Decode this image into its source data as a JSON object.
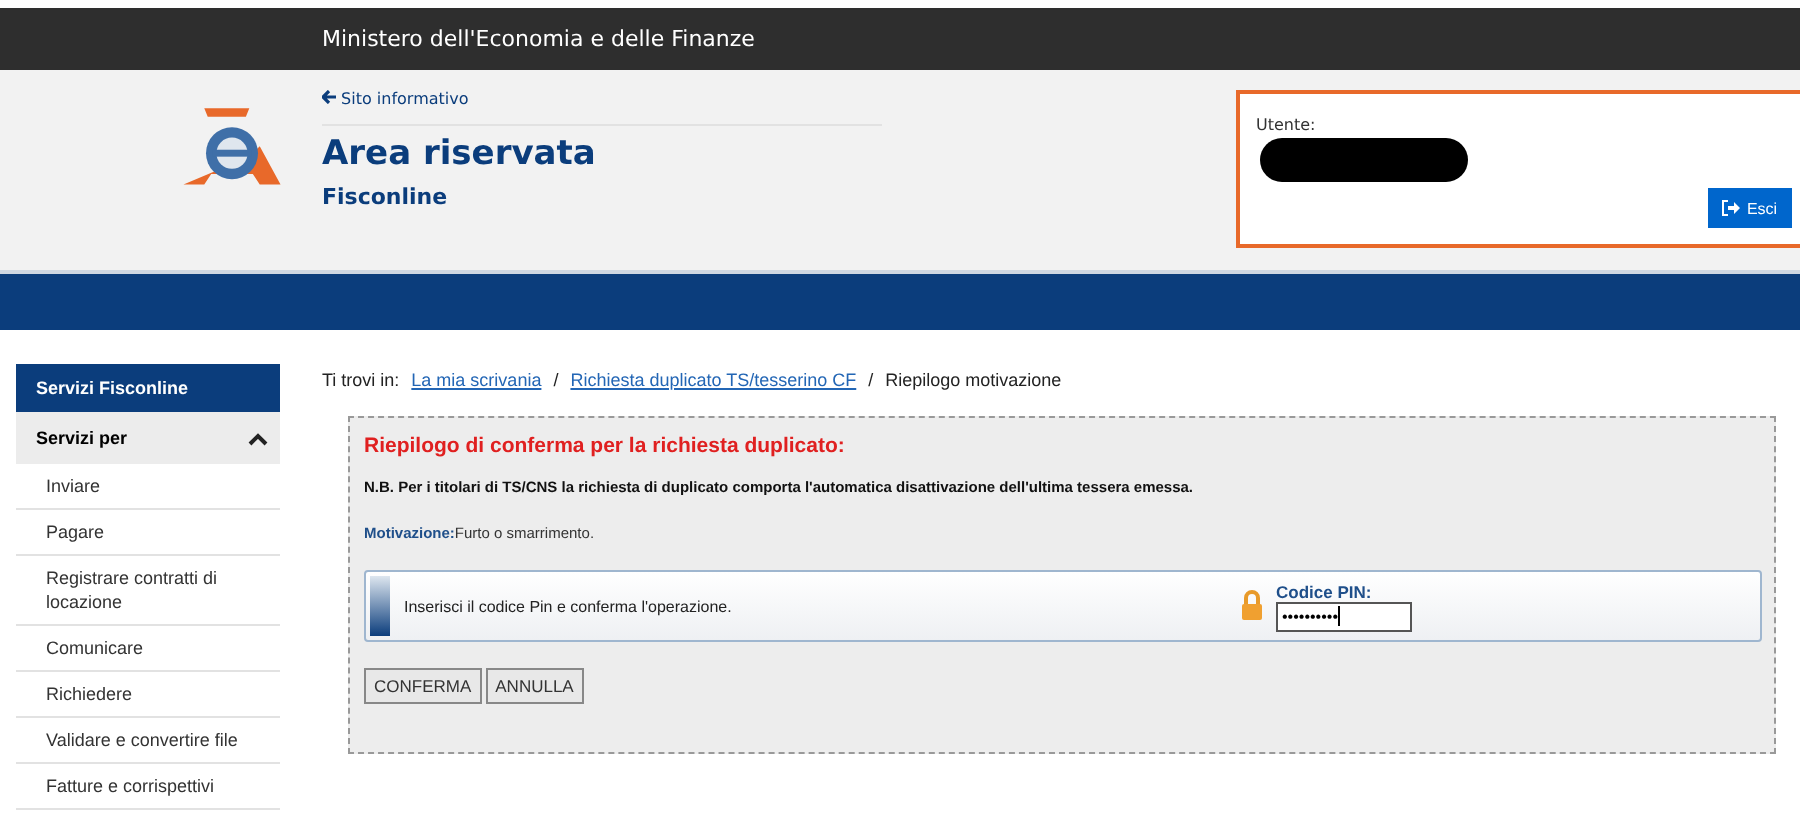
{
  "top_bar": {
    "title": "Ministero dell'Economia e delle Finanze"
  },
  "header": {
    "back_link": "Sito informativo",
    "title": "Area riservata",
    "subtitle": "Fisconline"
  },
  "user_box": {
    "label": "Utente:",
    "logout_button": "Esci"
  },
  "sidebar": {
    "title": "Servizi Fisconline",
    "group": {
      "label": "Servizi per",
      "expanded": true
    },
    "items": [
      {
        "label": "Inviare"
      },
      {
        "label": "Pagare"
      },
      {
        "label": "Registrare contratti di locazione"
      },
      {
        "label": "Comunicare"
      },
      {
        "label": "Richiedere"
      },
      {
        "label": "Validare e convertire file"
      },
      {
        "label": "Fatture e corrispettivi"
      }
    ]
  },
  "breadcrumb": {
    "prefix": "Ti trovi in:",
    "parts": [
      {
        "kind": "link",
        "text": "La mia scrivania"
      },
      {
        "kind": "separator",
        "text": "/"
      },
      {
        "kind": "link",
        "text": "Richiesta duplicato TS/tesserino CF"
      },
      {
        "kind": "separator",
        "text": "/"
      },
      {
        "kind": "current",
        "text": "Riepilogo motivazione"
      }
    ]
  },
  "panel": {
    "title": "Riepilogo di conferma per la richiesta duplicato:",
    "note": "N.B. Per i titolari di TS/CNS la richiesta di duplicato comporta l'automatica disattivazione dell'ultima tessera emessa.",
    "reason_label": "Motivazione:",
    "reason_value": "Furto o smarrimento.",
    "pin_box": {
      "message": "Inserisci il codice Pin e conferma l'operazione.",
      "pin_label": "Codice PIN:",
      "pin_value": "••••••••••"
    },
    "buttons": [
      "CONFERMA",
      "ANNULLA"
    ]
  }
}
